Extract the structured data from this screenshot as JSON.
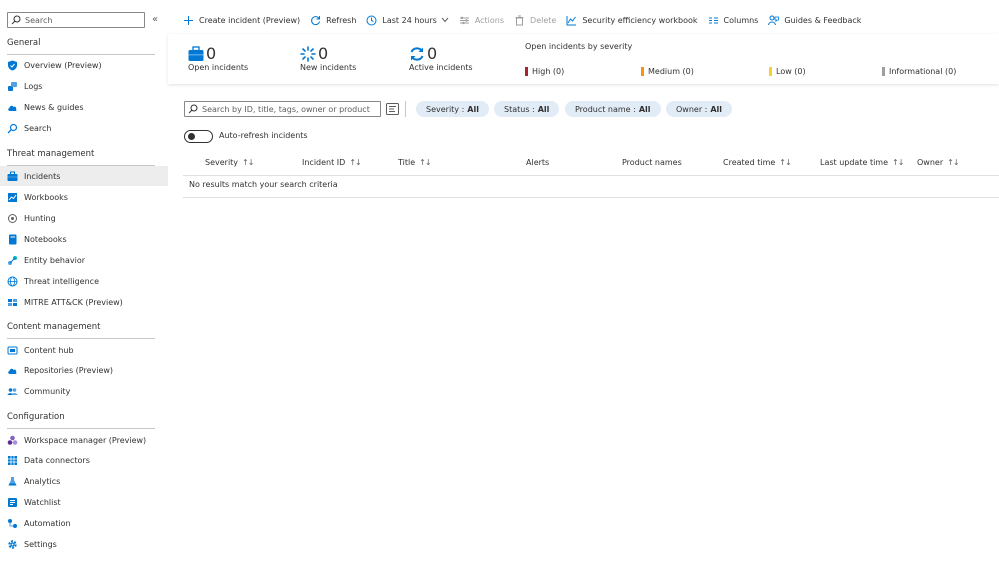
{
  "sidebar": {
    "search_placeholder": "Search",
    "collapse_icon": "«",
    "sections": [
      {
        "title": "General",
        "items": [
          {
            "label": "Overview (Preview)",
            "icon": "shield-icon"
          },
          {
            "label": "Logs",
            "icon": "logs-icon"
          },
          {
            "label": "News & guides",
            "icon": "cloud-icon"
          },
          {
            "label": "Search",
            "icon": "search-icon"
          }
        ]
      },
      {
        "title": "Threat management",
        "items": [
          {
            "label": "Incidents",
            "icon": "briefcase-icon"
          },
          {
            "label": "Workbooks",
            "icon": "workbook-icon"
          },
          {
            "label": "Hunting",
            "icon": "target-icon"
          },
          {
            "label": "Notebooks",
            "icon": "notebook-icon"
          },
          {
            "label": "Entity behavior",
            "icon": "entity-icon"
          },
          {
            "label": "Threat intelligence",
            "icon": "globe-icon"
          },
          {
            "label": "MITRE ATT&CK (Preview)",
            "icon": "mitre-icon"
          }
        ]
      },
      {
        "title": "Content management",
        "items": [
          {
            "label": "Content hub",
            "icon": "hub-icon"
          },
          {
            "label": "Repositories (Preview)",
            "icon": "cloud-icon"
          },
          {
            "label": "Community",
            "icon": "community-icon"
          }
        ]
      },
      {
        "title": "Configuration",
        "items": [
          {
            "label": "Workspace manager (Preview)",
            "icon": "workspace-icon"
          },
          {
            "label": "Data connectors",
            "icon": "grid-icon"
          },
          {
            "label": "Analytics",
            "icon": "flask-icon"
          },
          {
            "label": "Watchlist",
            "icon": "watchlist-icon"
          },
          {
            "label": "Automation",
            "icon": "automation-icon"
          },
          {
            "label": "Settings",
            "icon": "gear-icon"
          }
        ]
      }
    ]
  },
  "toolbar": {
    "create": "Create incident (Preview)",
    "refresh": "Refresh",
    "timerange": "Last 24 hours",
    "actions": "Actions",
    "delete": "Delete",
    "workbook": "Security efficiency workbook",
    "columns": "Columns",
    "guides": "Guides & Feedback"
  },
  "summary": {
    "open": {
      "value": "0",
      "label": "Open incidents"
    },
    "new": {
      "value": "0",
      "label": "New incidents"
    },
    "active": {
      "value": "0",
      "label": "Active incidents"
    },
    "severity_title": "Open incidents by severity",
    "severity": [
      {
        "label": "High (0)",
        "color": "#a4262c"
      },
      {
        "label": "Medium (0)",
        "color": "#f7930e"
      },
      {
        "label": "Low (0)",
        "color": "#f8d22a"
      },
      {
        "label": "Informational (0)",
        "color": "#a19f9d"
      }
    ]
  },
  "filters": {
    "search_placeholder": "Search by ID, title, tags, owner or product",
    "pills": [
      {
        "name": "Severity :",
        "value": "All"
      },
      {
        "name": "Status :",
        "value": "All"
      },
      {
        "name": "Product name :",
        "value": "All"
      },
      {
        "name": "Owner :",
        "value": "All"
      }
    ]
  },
  "autorefresh": {
    "label": "Auto-refresh incidents",
    "on": false
  },
  "table": {
    "columns": [
      "Severity",
      "Incident ID",
      "Title",
      "Alerts",
      "Product names",
      "Created time",
      "Last update time",
      "Owner"
    ],
    "sort_icon": "↑↓",
    "empty_message": "No results match your search criteria"
  }
}
